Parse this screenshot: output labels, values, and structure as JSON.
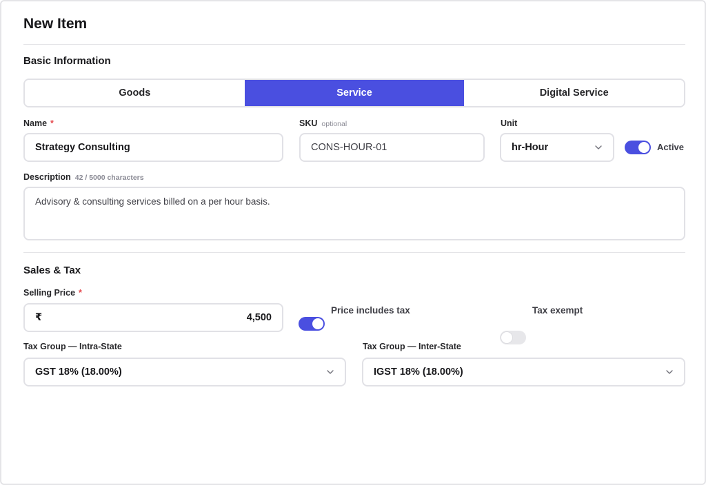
{
  "page": {
    "title": "New Item"
  },
  "basic": {
    "section_title": "Basic Information",
    "item_types": [
      {
        "label": "Goods",
        "selected": false
      },
      {
        "label": "Service",
        "selected": true
      },
      {
        "label": "Digital Service",
        "selected": false
      }
    ],
    "name": {
      "label": "Name",
      "required_mark": "*",
      "value": "Strategy Consulting"
    },
    "sku": {
      "label": "SKU",
      "hint": "optional",
      "value": "CONS-HOUR-01"
    },
    "unit": {
      "label": "Unit",
      "value": "hr-Hour"
    },
    "active": {
      "label": "Active",
      "on": true
    },
    "description": {
      "label": "Description",
      "counter": "42 / 5000 characters",
      "value": "Advisory & consulting services billed on a per hour basis."
    }
  },
  "sales_tax": {
    "section_title": "Sales & Tax",
    "selling_price": {
      "label": "Selling Price",
      "required_mark": "*",
      "currency_symbol": "₹",
      "value": "4,500"
    },
    "price_includes_tax": {
      "label": "Price includes tax",
      "on": true
    },
    "tax_exempt": {
      "label": "Tax exempt",
      "on": false
    },
    "intra_state": {
      "label": "Tax Group — Intra-State",
      "value": "GST 18% (18.00%)"
    },
    "inter_state": {
      "label": "Tax Group — Inter-State",
      "value": "IGST 18% (18.00%)"
    }
  },
  "colors": {
    "accent": "#4a4fe0",
    "required": "#e5484d",
    "border": "#e1e1e6"
  }
}
